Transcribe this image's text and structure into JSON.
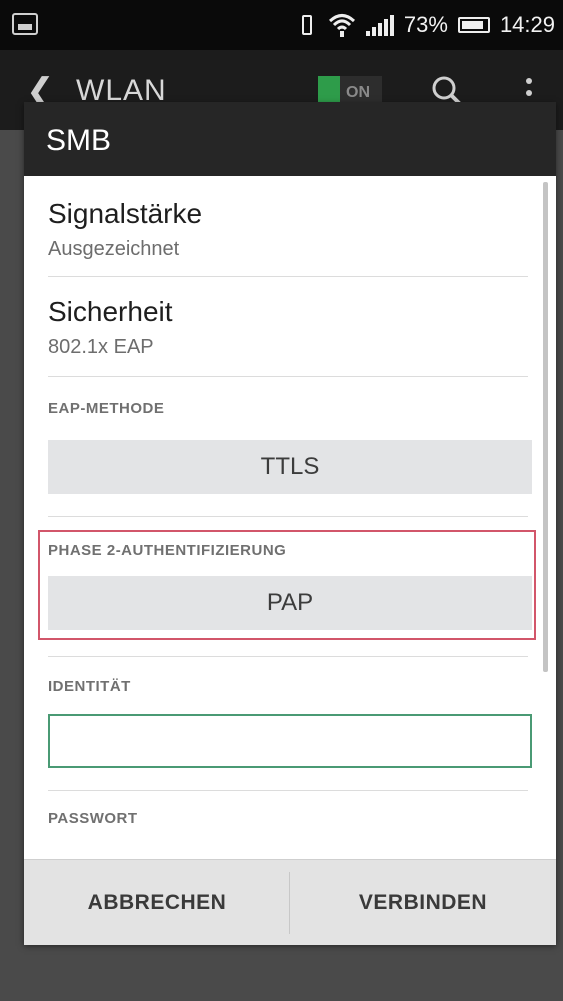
{
  "status_bar": {
    "battery_percent": "73%",
    "time": "14:29",
    "icons": [
      "gallery-icon",
      "vibrate-icon",
      "wifi-icon",
      "signal-icon",
      "battery-icon"
    ]
  },
  "app_bar": {
    "title": "WLAN",
    "toggle_label": "ON",
    "toggle_state": "on",
    "accent_color": "#2e9c4a",
    "icons": [
      "back-icon",
      "search-icon",
      "overflow-menu-icon"
    ]
  },
  "dialog": {
    "title": "SMB",
    "signal": {
      "title": "Signalstärke",
      "value": "Ausgezeichnet"
    },
    "security": {
      "title": "Sicherheit",
      "value": "802.1x EAP"
    },
    "eap_method": {
      "label": "EAP-METHODE",
      "selected": "TTLS"
    },
    "phase2": {
      "label": "PHASE 2-AUTHENTIFIZIERUNG",
      "selected": "PAP",
      "highlight_color": "#d2566a"
    },
    "identity": {
      "label": "IDENTITÄT",
      "value": ""
    },
    "password": {
      "label": "PASSWORT"
    },
    "buttons": {
      "cancel": "ABBRECHEN",
      "connect": "VERBINDEN"
    }
  }
}
